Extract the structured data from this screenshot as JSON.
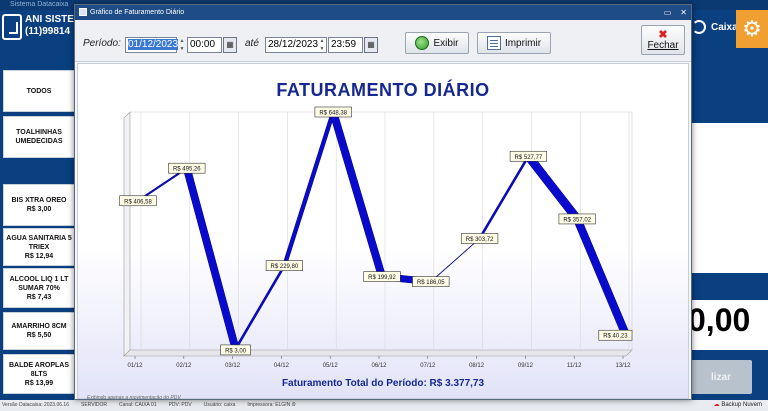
{
  "background": {
    "window_title": "Sistema Datacaixa",
    "company_line1": "ANI SISTE",
    "company_line2": "(11)99814",
    "caixa_label": "Caixa",
    "sidebar_items": [
      {
        "name": "TODOS",
        "price": ""
      },
      {
        "name": "TOALHINHAS UMEDECIDAS",
        "price": ""
      },
      {
        "name": "BIS XTRA OREO",
        "price": "R$ 3,00"
      },
      {
        "name": "AGUA SANITARIA 5 TRIEX",
        "price": "R$ 12,94"
      },
      {
        "name": "ALCOOL LIQ 1 LT SUMAR 70%",
        "price": "R$ 7,43"
      },
      {
        "name": "AMARRIHO 8CM",
        "price": "R$ 5,50"
      },
      {
        "name": "BALDE AROPLAS 8LTS",
        "price": "R$ 13,99"
      }
    ],
    "big_value": "0,00",
    "finalize_fragment": "lizar",
    "status_items": [
      "Versão Datacaixa: 2023.06.16",
      "SERVIDOR",
      "Canal: CAIXA 01",
      "PDV: PDV",
      "Usuário: caixa",
      "Impressora: ELGIN i9"
    ],
    "backup_label": "Backup Nuvem"
  },
  "dialog": {
    "title": "Gráfico de Faturamento Diário",
    "periodo_label": "Período:",
    "start_date": "01/12/2023",
    "start_time": "00:00",
    "ate_label": "até",
    "end_date": "28/12/2023",
    "end_time": "23:59",
    "exibir_label": "Exibir",
    "imprimir_label": "Imprimir",
    "fechar_label": "Fechar"
  },
  "chart_data": {
    "type": "line",
    "title": "FATURAMENTO DIÁRIO",
    "x": [
      "01/12",
      "02/12",
      "03/12",
      "04/12",
      "05/12",
      "06/12",
      "07/12",
      "08/12",
      "09/12",
      "11/12",
      "13/12"
    ],
    "values": [
      406.58,
      495.26,
      3.0,
      229.8,
      648.38,
      199.92,
      186.05,
      303.72,
      527.77,
      357.02,
      40.23
    ],
    "labels": [
      "R$ 406,58",
      "R$ 495,26",
      "R$ 3,00",
      "R$ 229,80",
      "R$ 648,38",
      "R$ 199,92",
      "R$ 186,05",
      "R$ 303,72",
      "R$ 527,77",
      "R$ 357,02",
      "R$ 40,23"
    ],
    "ylim": [
      0,
      648.38
    ],
    "color": "#0a0acc",
    "grid": "vertical",
    "total_text": "Faturamento Total do Período: R$ 3.377,73",
    "note": "Exibindo apenas a movimentação do PDV."
  }
}
